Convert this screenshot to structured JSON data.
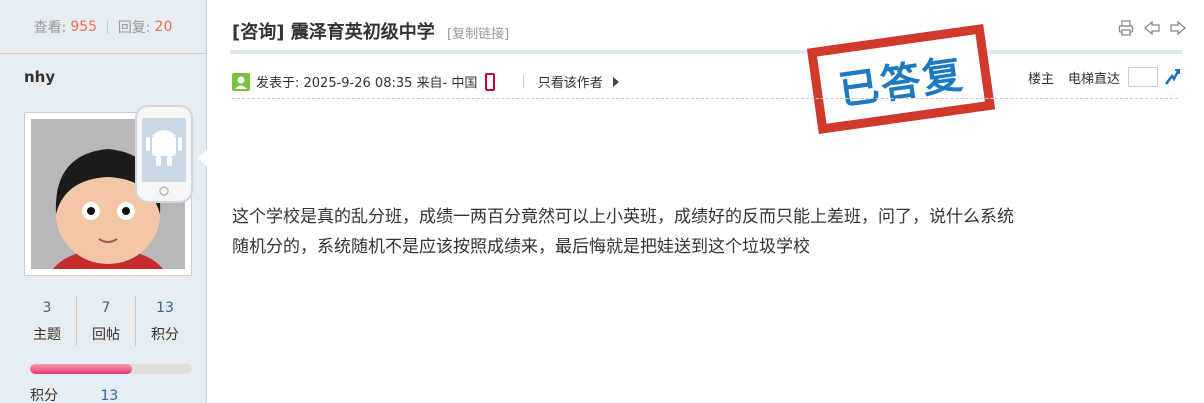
{
  "sidebar": {
    "views_label": "查看:",
    "views": "955",
    "replies_label": "回复:",
    "replies": "20",
    "username": "nhy",
    "counts": [
      {
        "value": "3",
        "label": "主题"
      },
      {
        "value": "7",
        "label": "回帖"
      },
      {
        "value": "13",
        "label": "积分"
      }
    ],
    "progress_fraction": 0.63,
    "score_label": "积分",
    "score_value": "13"
  },
  "post": {
    "title": "[咨询] 震泽育英初级中学",
    "copy_link": "[复制链接]",
    "posted_at": "发表于: 2025-9-26 08:35 来自- 中国",
    "only_author": "只看该作者",
    "floor": "楼主",
    "elevator": "电梯直达",
    "stamp": "已答复",
    "content_line1": "这个学校是真的乱分班，成绩一两百分竟然可以上小英班，成绩好的反而只能上差班，问了，说什么系统",
    "content_line2": "随机分的，系统随机不是应该按照成绩来，最后悔就是把娃送到这个垃圾学校"
  },
  "icons": {
    "print": "printer-icon",
    "prev": "arrow-left-icon",
    "next": "arrow-right-icon"
  },
  "colors": {
    "accent_red": "#f26c4f",
    "stamp_red": "#d0392b",
    "stamp_blue": "#1d7ac2",
    "link_blue": "#336699"
  }
}
